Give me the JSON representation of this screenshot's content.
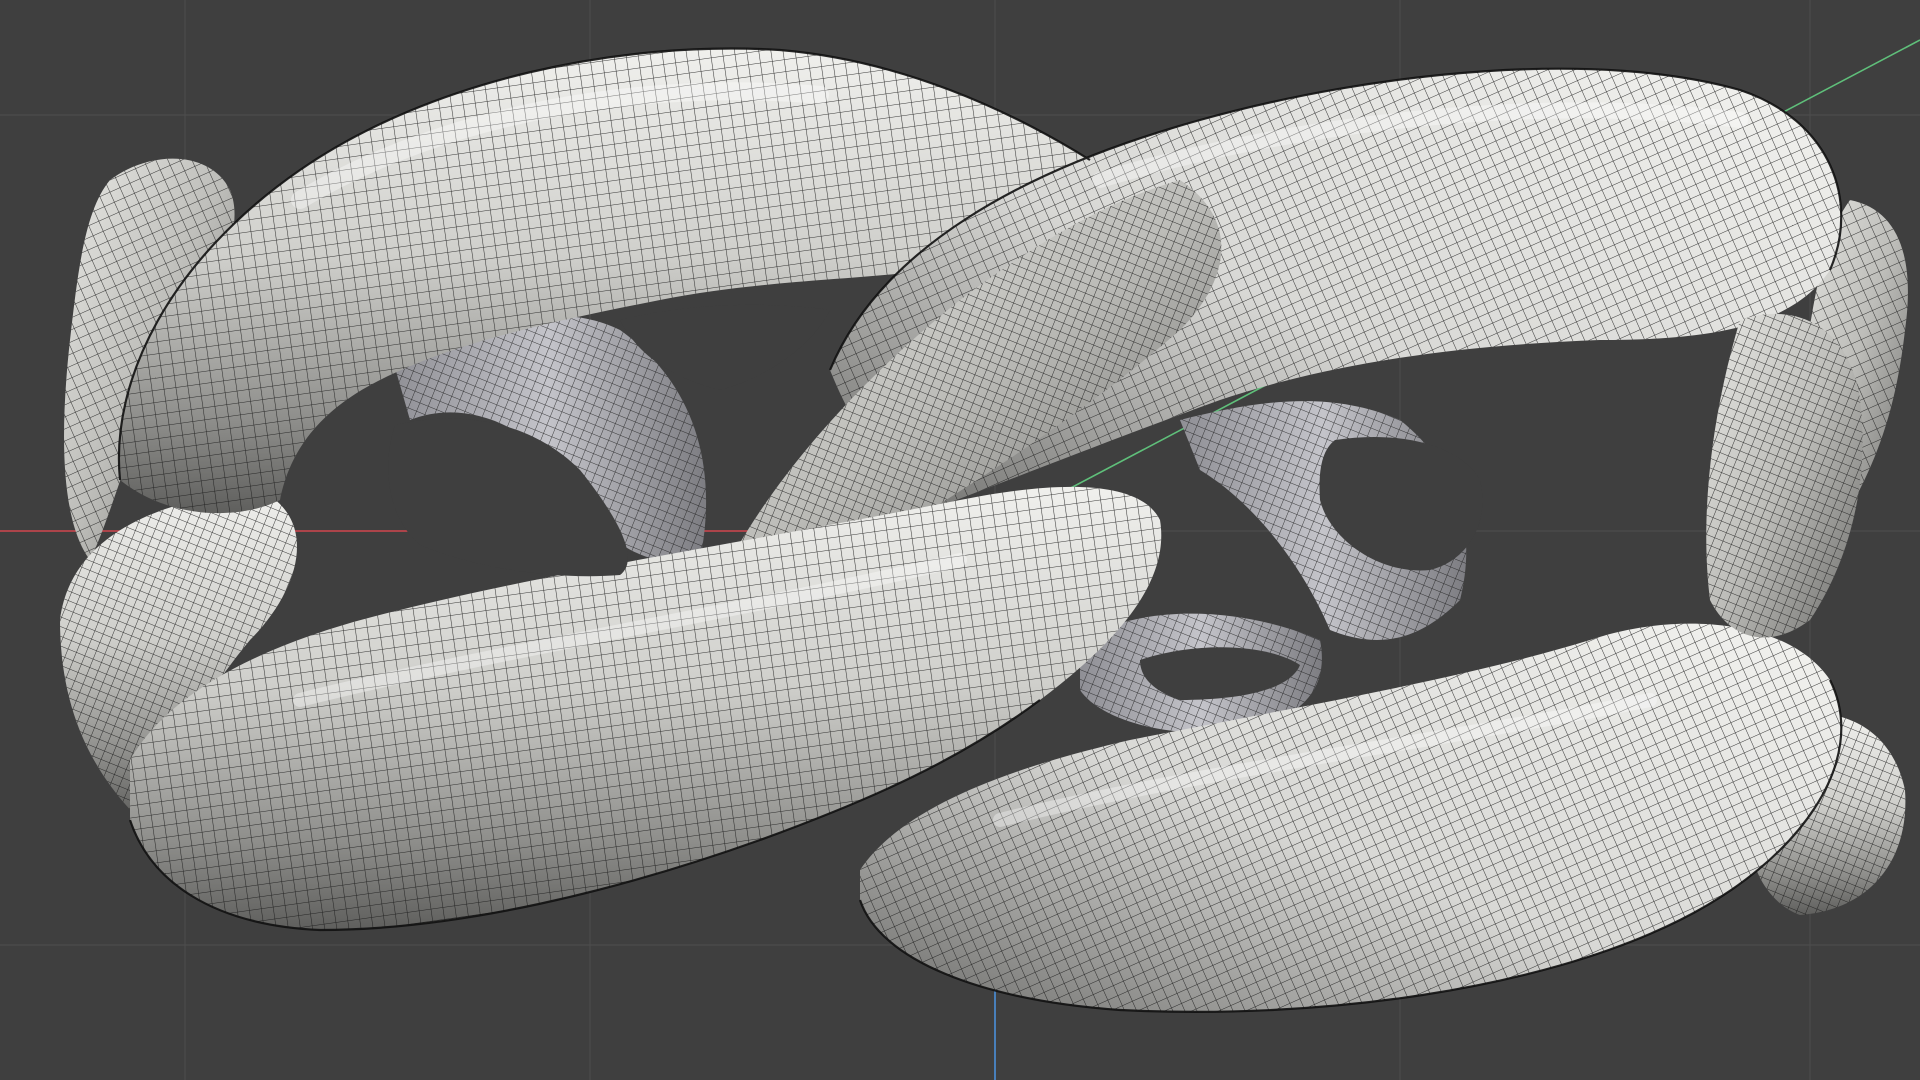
{
  "app": {
    "view": "3d-viewport",
    "shading": "wireframe-over-solid"
  },
  "viewport": {
    "background_color": "#3f3f3f",
    "grid_color": "#4c4c4c",
    "axis_x_color": "#d0454c",
    "axis_y_color": "#5fbf7a",
    "axis_z_color": "#4a8fd8",
    "show_grid": true,
    "show_axes": true
  },
  "model": {
    "type": "interlocked-chain-links",
    "surface_color": "#c9c9c6",
    "highlight_color": "#f2f2ef",
    "shadow_color": "#6b6b69",
    "wire_color": "#1a1a1a",
    "object_icon": "mesh-icon"
  }
}
